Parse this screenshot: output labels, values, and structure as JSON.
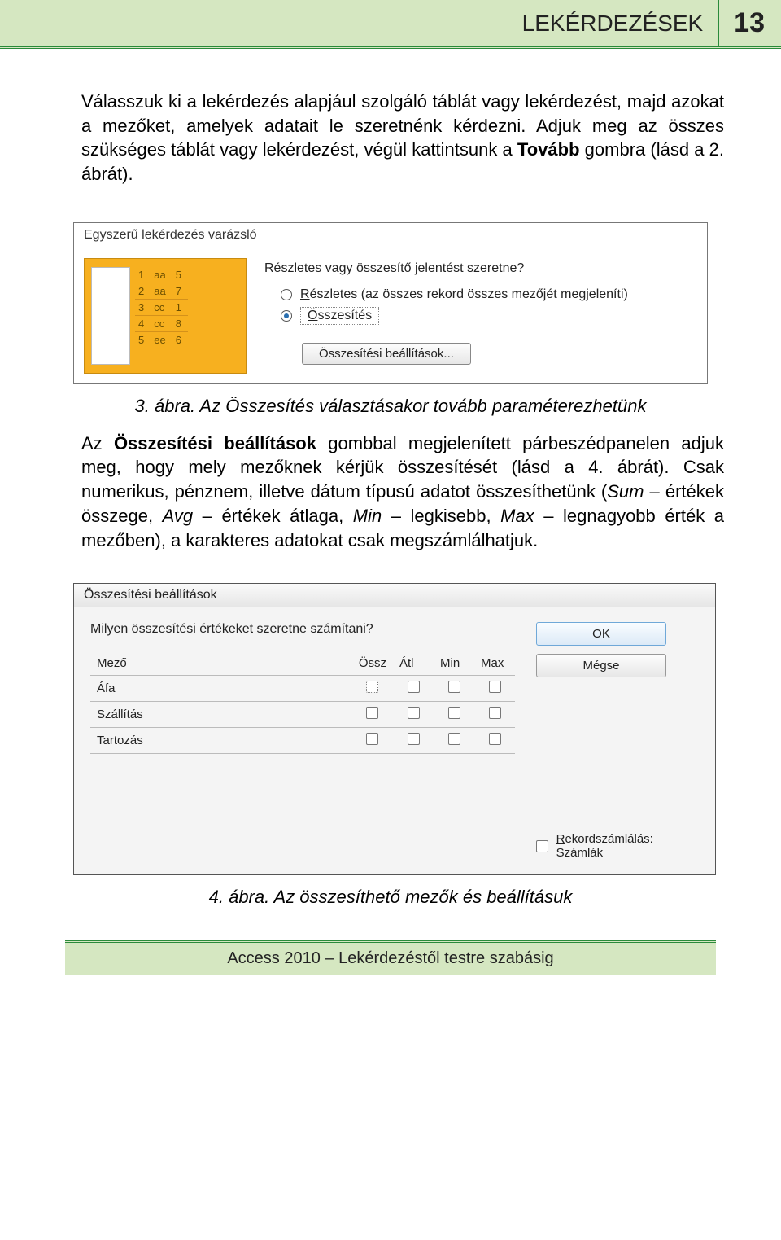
{
  "header": {
    "title": "LEKÉRDEZÉSEK",
    "page_number": "13"
  },
  "para1_a": "Válasszuk ki a lekérdezés alapjául szolgáló táblát vagy lekérdezést, majd azokat a mezőket, amelyek adatait le szeretnénk kérdezni. Adjuk meg az összes szükséges táblát vagy lekérdezést, végül kattintsunk a ",
  "para1_bold": "Tovább",
  "para1_b": " gombra (lásd a 2. ábrát).",
  "shot1": {
    "title": "Egyszerű lekérdezés varázsló",
    "thumb_rows": [
      [
        "1",
        "aa",
        "5"
      ],
      [
        "2",
        "aa",
        "7"
      ],
      [
        "3",
        "cc",
        "1"
      ],
      [
        "4",
        "cc",
        "8"
      ],
      [
        "5",
        "ee",
        "6"
      ]
    ],
    "question": "Részletes vagy összesítő jelentést szeretne?",
    "opt1_underline": "R",
    "opt1_rest": "észletes (az összes rekord összes mezőjét megjeleníti)",
    "opt2_underline": "Ö",
    "opt2_rest": "sszesítés",
    "button": "Összesítési beállítások..."
  },
  "caption1": "3. ábra. Az Összesítés választásakor tovább paraméterezhetünk",
  "para2_a": "Az ",
  "para2_bold": "Összesítési beállítások",
  "para2_b": " gombbal megjelenített párbeszédpanelen adjuk meg, hogy mely mezőknek kérjük összesítését (lásd a 4. ábrát). Csak numerikus, pénznem, illetve dátum típusú adatot összesíthetünk (",
  "para2_i1": "Sum",
  "para2_c": " – értékek összege, ",
  "para2_i2": "Avg",
  "para2_d": " – értékek átlaga, ",
  "para2_i3": "Min",
  "para2_e": " – legkisebb, ",
  "para2_i4": "Max",
  "para2_f": " – legnagyobb érték a mezőben), a karakteres adatokat csak megszámlálhatjuk.",
  "shot2": {
    "title": "Összesítési beállítások",
    "question": "Milyen összesítési értékeket szeretne számítani?",
    "cols": [
      "Mező",
      "Össz",
      "Átl",
      "Min",
      "Max"
    ],
    "rows": [
      "Áfa",
      "Szállítás",
      "Tartozás"
    ],
    "ok": "OK",
    "cancel": "Mégse",
    "recordcount_u": "R",
    "recordcount_rest": "ekordszámlálás: Számlák"
  },
  "caption2": "4. ábra. Az összesíthető mezők és beállításuk",
  "footer": "Access 2010 – Lekérdezéstől testre szabásig"
}
